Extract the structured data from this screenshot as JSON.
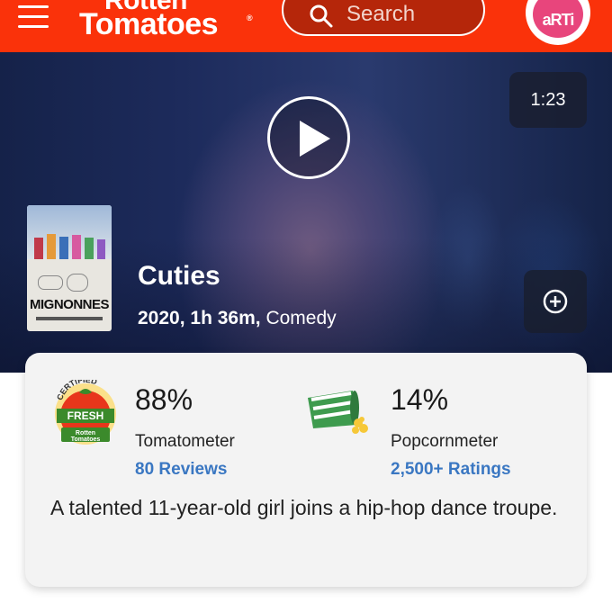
{
  "header": {
    "logo_line1": "Rotten",
    "logo_line2": "Tomatoes",
    "logo_reg": "®",
    "search_placeholder": "Search",
    "avatar_text": "aRTi",
    "brand_color": "#fa320a"
  },
  "hero": {
    "duration": "1:23",
    "poster_title": "MIGNONNES",
    "title": "Cuties",
    "year_runtime": "2020, 1h 36m,",
    "genre": "Comedy"
  },
  "ratings": {
    "tomatometer_badge": "CERTIFIED FRESH",
    "tomatometer_score": "88%",
    "tomatometer_label": "Tomatometer",
    "tomatometer_link": "80 Reviews",
    "popcorn_score": "14%",
    "popcorn_label": "Popcornmeter",
    "popcorn_link": "2,500+ Ratings",
    "link_color": "#3a77c2"
  },
  "synopsis": "A talented 11-year-old girl joins a hip-hop dance troupe.",
  "icons": [
    "hamburger-menu-icon",
    "search-icon",
    "play-icon",
    "plus-circle-icon",
    "certified-fresh-icon",
    "spilled-popcorn-icon"
  ]
}
